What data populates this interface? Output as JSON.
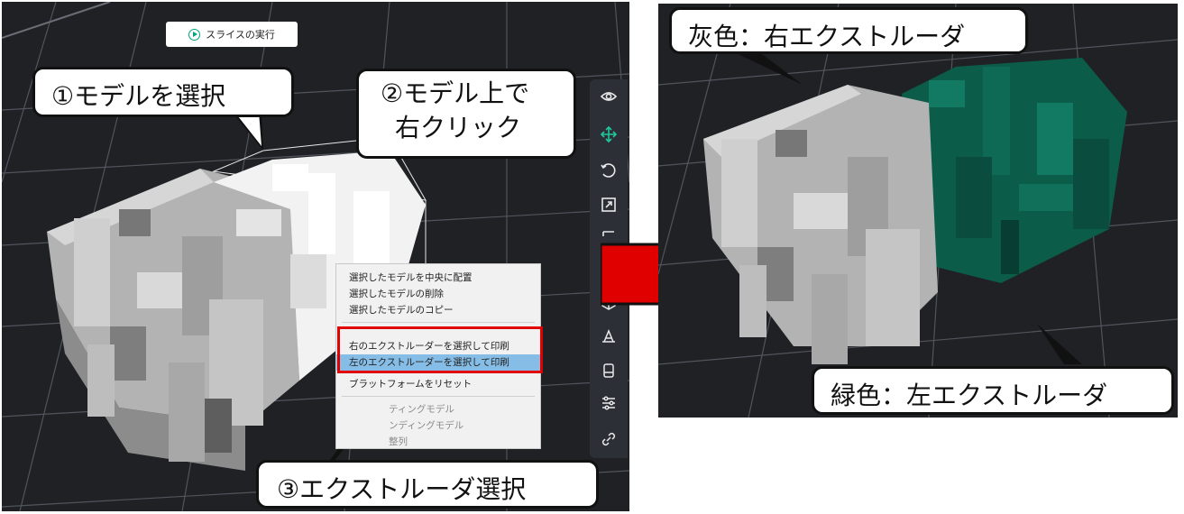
{
  "slice_button": {
    "label": "スライスの実行",
    "icon": "play-icon"
  },
  "callouts": {
    "select_model": "①モデルを選択",
    "right_click_line1": "②モデル上で",
    "right_click_line2": "右クリック",
    "extruder_select": "③エクストルーダ選択",
    "gray_right": "灰色：右エクストルーダ",
    "green_left": "緑色：左エクストルーダ"
  },
  "context_menu": {
    "items": [
      {
        "label": "選択したモデルを中央に配置",
        "state": "normal"
      },
      {
        "label": "選択したモデルの削除",
        "state": "normal"
      },
      {
        "label": "選択したモデルのコピー",
        "state": "normal"
      },
      {
        "label": "右のエクストルーダーを選択して印刷",
        "state": "normal"
      },
      {
        "label": "左のエクストルーダーを選択して印刷",
        "state": "selected"
      },
      {
        "label": "ブラットフォームをリセット",
        "state": "normal"
      },
      {
        "label": "ティングモデル",
        "state": "disabled"
      },
      {
        "label": "ンディングモデル",
        "state": "disabled"
      },
      {
        "label": "整列",
        "state": "disabled"
      }
    ]
  },
  "toolbar": {
    "icons": [
      "eye-icon",
      "move-icon",
      "rotate-icon",
      "scale-icon",
      "mirror-icon",
      "cube-icon",
      "support-icon",
      "layer-icon",
      "settings-sliders-icon",
      "link-icon"
    ]
  },
  "colors": {
    "viewport_bg": "#1f2125",
    "model_gray": "#b9b9b9",
    "model_green": "#0c5c4a",
    "accent_red": "#e00000",
    "menu_selected": "#86bde6"
  }
}
